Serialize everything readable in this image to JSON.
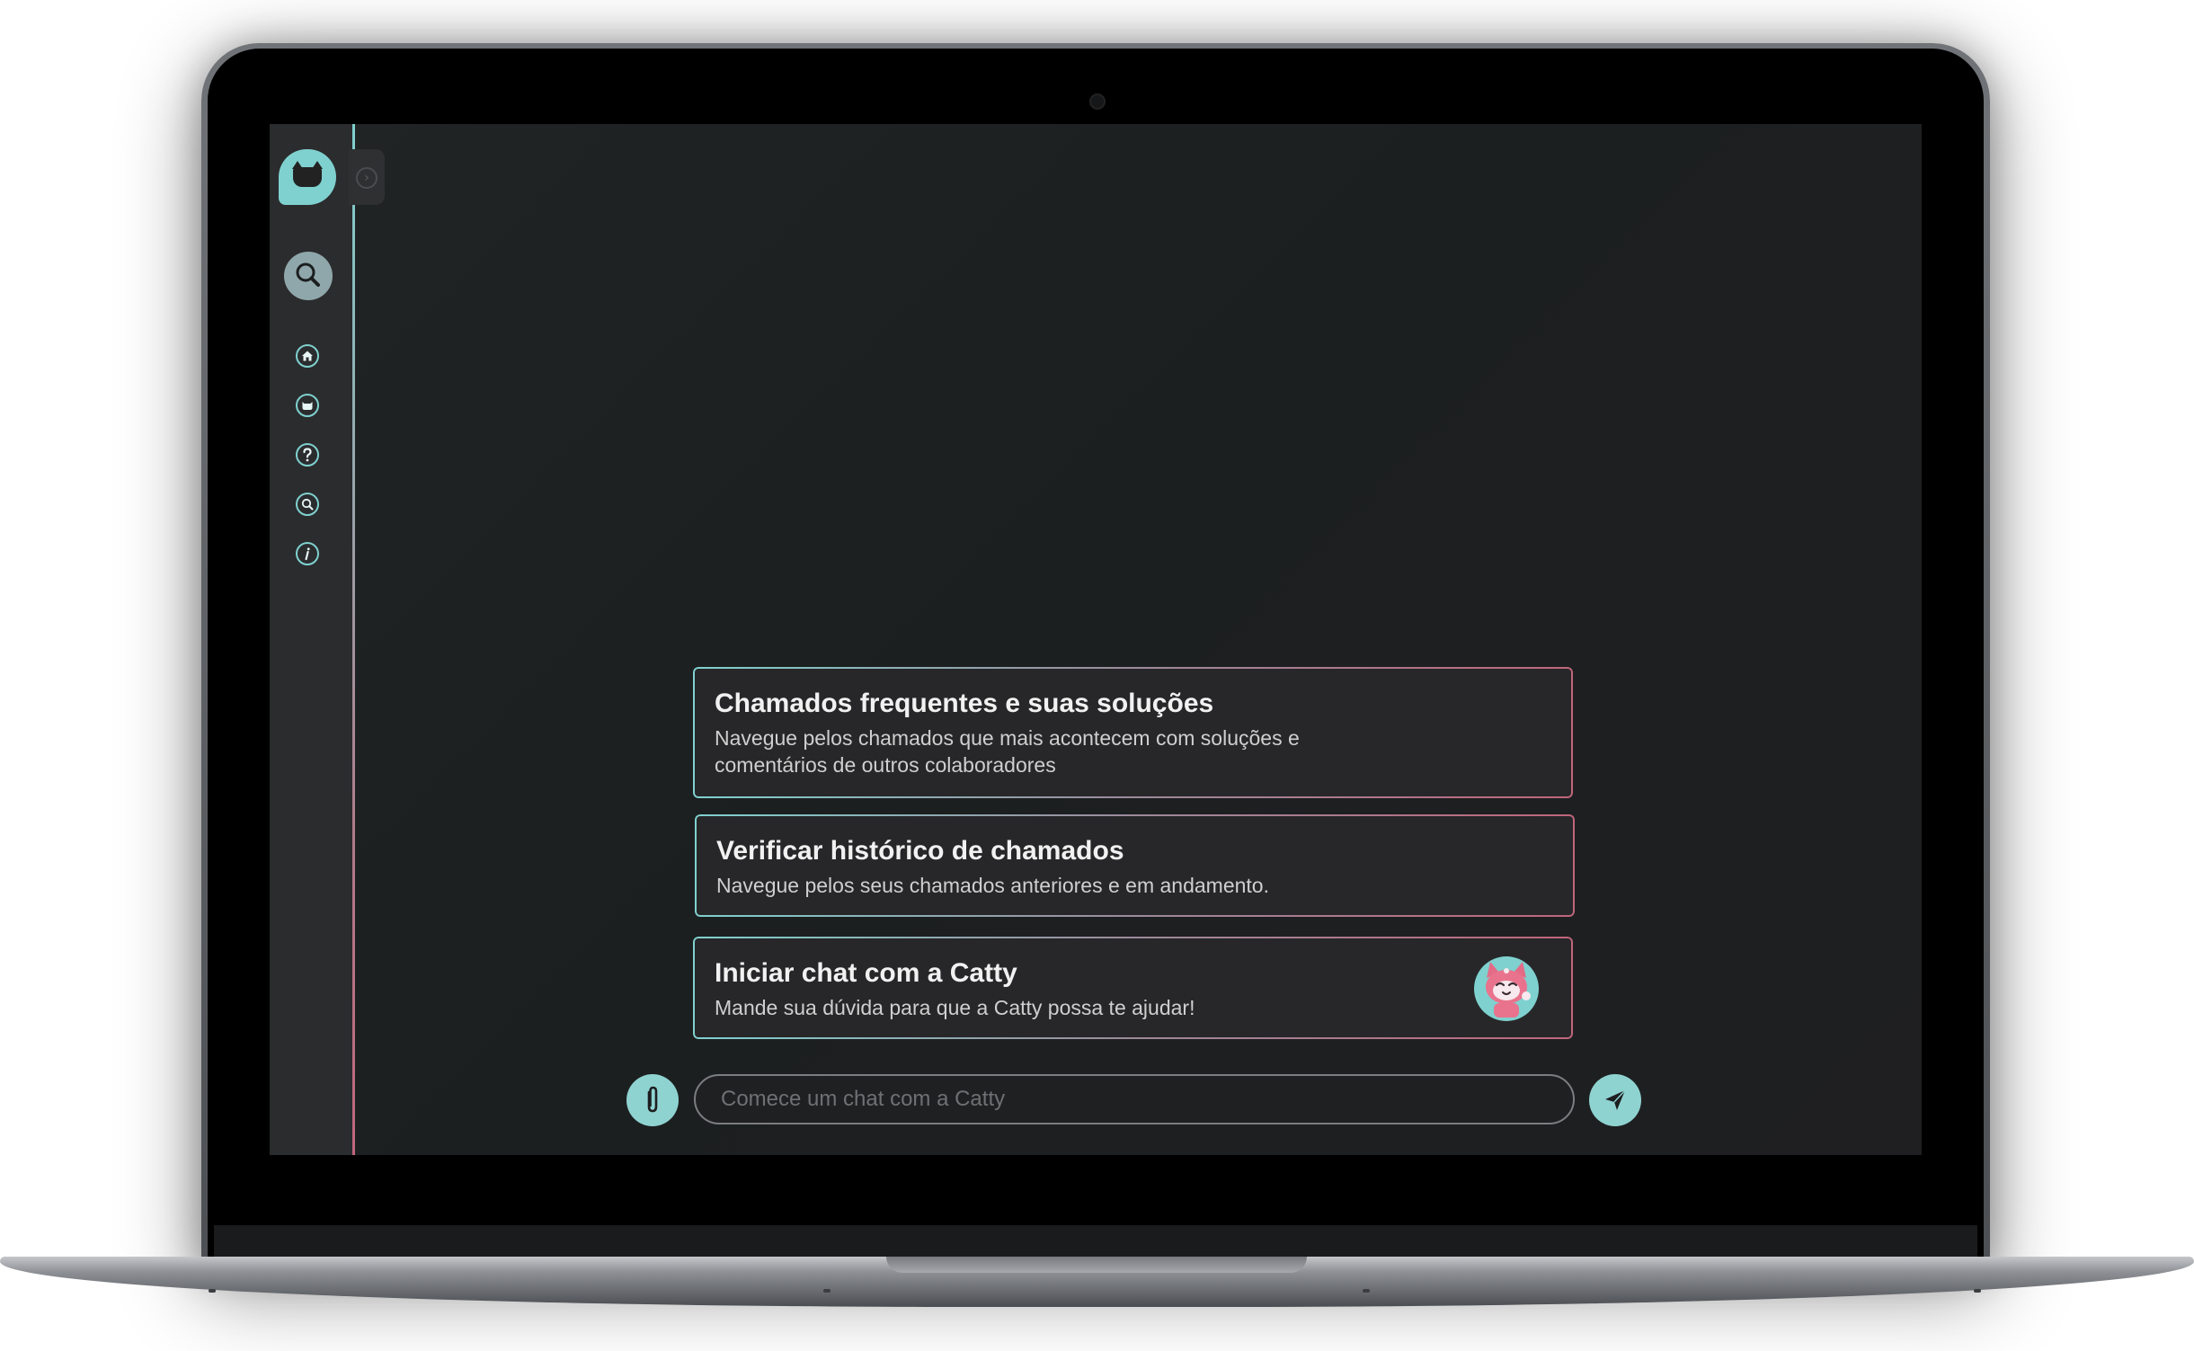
{
  "nav": {
    "items": [
      {
        "icon": "home-icon",
        "label": ""
      },
      {
        "icon": "cat-icon",
        "label": ""
      },
      {
        "icon": "help-icon",
        "label": ""
      },
      {
        "icon": "search-icon",
        "label": ""
      },
      {
        "icon": "info-icon",
        "label": ""
      }
    ]
  },
  "options": [
    {
      "title": "Chamados frequentes e suas soluções",
      "description": "Navegue pelos chamados que mais acontecem com soluções e comentários de outros colaboradores"
    },
    {
      "title": "Verificar histórico de chamados",
      "description": "Navegue pelos seus chamados anteriores e em andamento."
    },
    {
      "title": "Iniciar chat com a Catty",
      "description": "Mande sua dúvida para que a Catty possa te ajudar!"
    }
  ],
  "chat": {
    "placeholder": "Comece um chat com a Catty"
  },
  "colors": {
    "accent": "#8fd3d1",
    "accent_pink": "#c0667c",
    "background": "#1e2122",
    "sidebar": "#2b2c2e",
    "card": "#272729"
  }
}
